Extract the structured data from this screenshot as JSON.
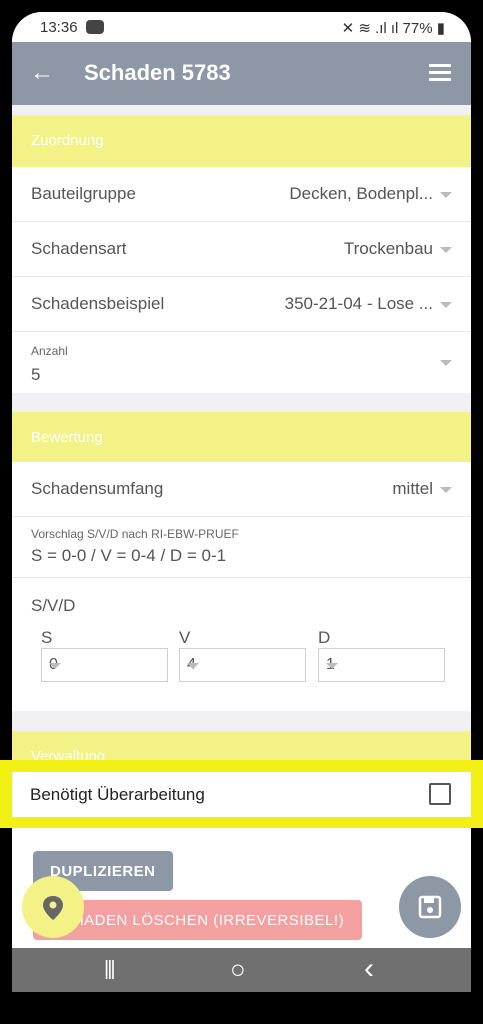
{
  "status": {
    "time": "13:36",
    "right": "✕ ≋ .ıl ıl 77% ▮"
  },
  "appbar": {
    "back_icon": "←",
    "title": "Schaden 5783"
  },
  "sections": {
    "zuordnung": "Zuordnung",
    "bewertung": "Bewertung",
    "verwaltung": "Verwaltung"
  },
  "zuordnung": {
    "bauteilgruppe_label": "Bauteilgruppe",
    "bauteilgruppe_value": "Decken, Bodenpl...",
    "schadensart_label": "Schadensart",
    "schadensart_value": "Trockenbau",
    "schadensbeispiel_label": "Schadensbeispiel",
    "schadensbeispiel_value": "350-21-04 - Lose ...",
    "anzahl_label": "Anzahl",
    "anzahl_value": "5"
  },
  "bewertung": {
    "umfang_label": "Schadensumfang",
    "umfang_value": "mittel",
    "vorschlag_label": "Vorschlag S/V/D nach RI-EBW-PRUEF",
    "vorschlag_value": "S = 0-0 / V = 0-4  / D = 0-1",
    "svd_label": "S/V/D",
    "s_label": "S",
    "s_value": "0",
    "v_label": "V",
    "v_value": "4",
    "d_label": "D",
    "d_value": "1"
  },
  "verwaltung": {
    "ueberarbeitung_label": "Benötigt Überarbeitung",
    "ueberarbeitung_checked": false
  },
  "buttons": {
    "duplizieren": "DUPLIZIEREN",
    "loeschen": "SCHADEN LÖSCHEN (IRREVERSIBEL!)"
  },
  "navbar": {
    "recent": "|||",
    "home": "○",
    "back": "‹"
  },
  "colors": {
    "appbar": "#8e97a5",
    "section": "#f2f286",
    "highlight": "#f2f014",
    "button_grey": "#8e97a5",
    "button_red": "#f4a0a0"
  }
}
